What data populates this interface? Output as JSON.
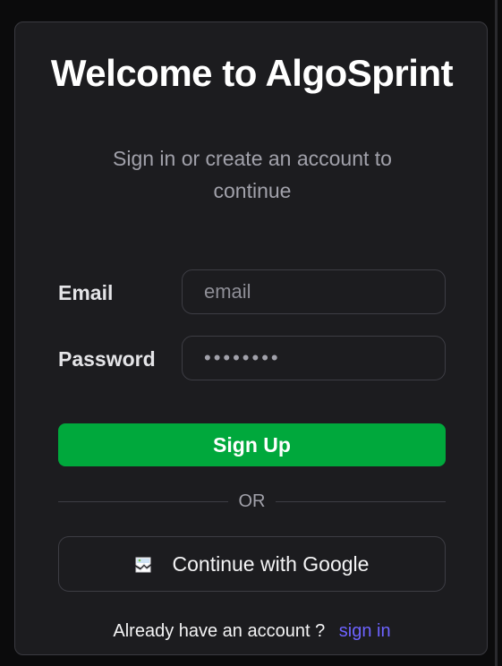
{
  "header": {
    "title": "Welcome to AlgoSprint",
    "subtitle": "Sign in or create an account to continue"
  },
  "form": {
    "email_label": "Email",
    "email_placeholder": "email",
    "email_value": "",
    "password_label": "Password",
    "password_placeholder": "••••••••",
    "password_value": "",
    "submit_label": "Sign Up"
  },
  "divider": {
    "text": "OR"
  },
  "oauth": {
    "google_label": "Continue with Google",
    "google_icon": "broken-image-icon"
  },
  "footer": {
    "prompt": "Already have an account ?",
    "link_label": "sign in"
  },
  "colors": {
    "background": "#0b0b0c",
    "card": "#1c1c1f",
    "primary_button": "#00a83c",
    "link": "#6d63ff"
  }
}
